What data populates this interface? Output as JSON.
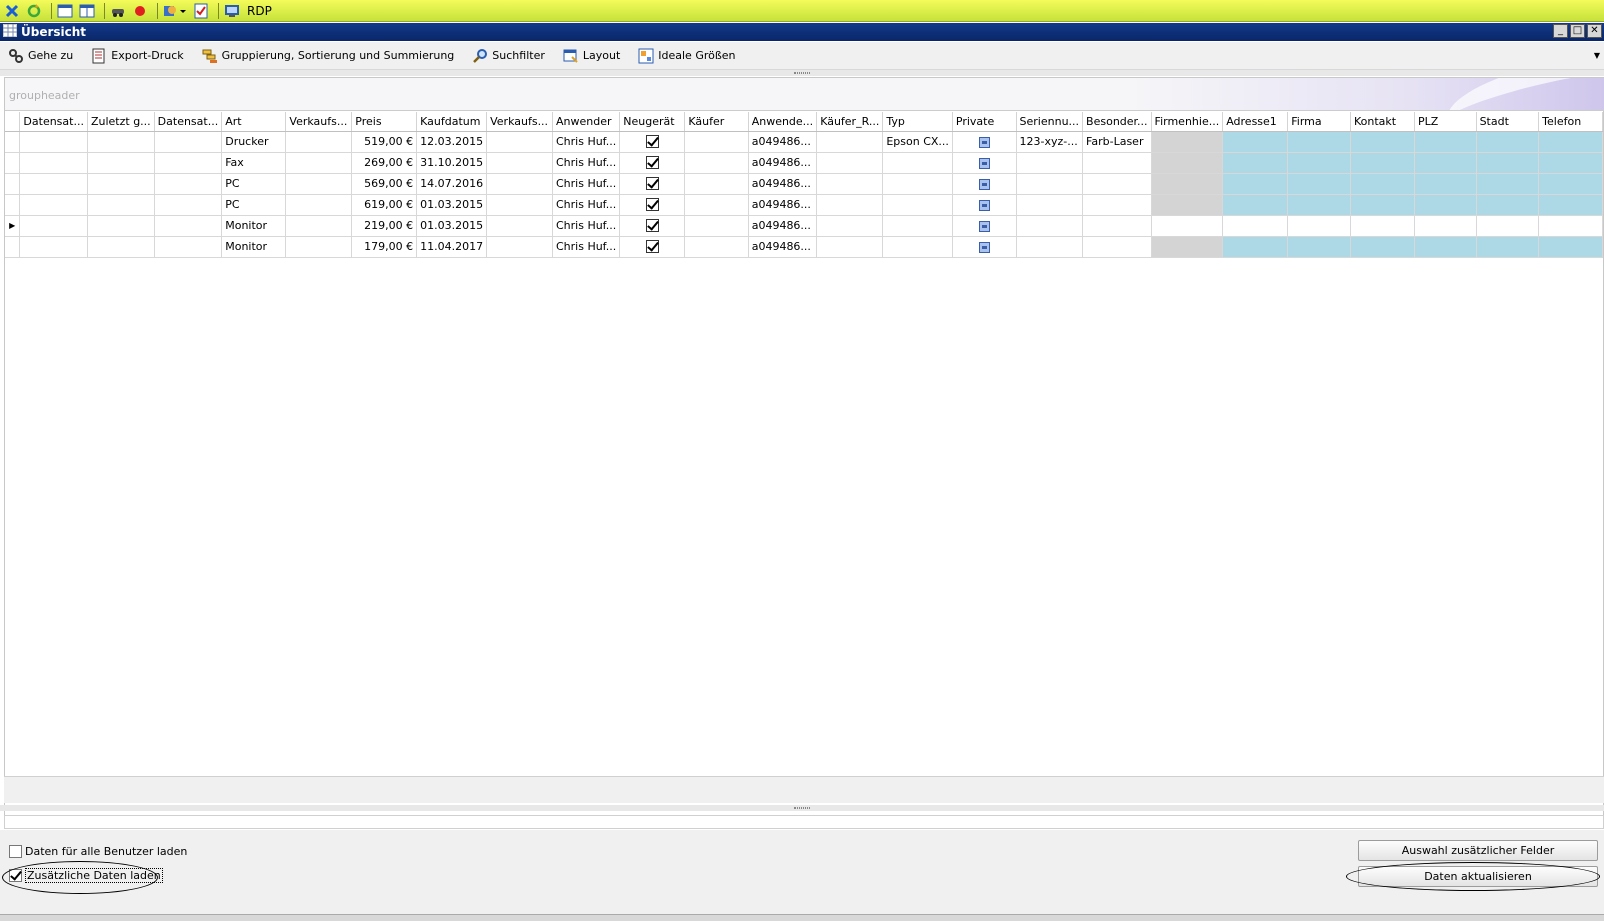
{
  "quickbar": {
    "rdp_label": "RDP"
  },
  "window": {
    "title": "Übersicht"
  },
  "toolbar": {
    "items": [
      {
        "label": "Gehe zu",
        "icon": "goto-icon"
      },
      {
        "label": "Export-Druck",
        "icon": "print-icon"
      },
      {
        "label": "Gruppierung, Sortierung und Summierung",
        "icon": "grouping-icon"
      },
      {
        "label": "Suchfilter",
        "icon": "search-filter-icon"
      },
      {
        "label": "Layout",
        "icon": "layout-icon"
      },
      {
        "label": "Ideale Größen",
        "icon": "ideal-size-icon"
      }
    ]
  },
  "grid": {
    "groupheader": "groupheader",
    "columns": [
      "Datensat...",
      "Zuletzt g...",
      "Datensat...",
      "Art",
      "Verkaufs...",
      "Preis",
      "Kaufdatum",
      "Verkaufs...",
      "Anwender",
      "Neugerät",
      "Käufer",
      "Anwende...",
      "Käufer_R...",
      "Typ",
      "Private",
      "Seriennu...",
      "Besonder...",
      "Firmenhie...",
      "Adresse1",
      "Firma",
      "Kontakt",
      "PLZ",
      "Stadt",
      "Telefon"
    ],
    "rows": [
      {
        "art": "Drucker",
        "preis": "519,00 €",
        "kaufdatum": "12.03.2015",
        "anwender": "Chris Huf...",
        "neugeraet": true,
        "anwender_id": "a049486...",
        "typ": "Epson CX...",
        "seriennummer": "123-xyz-...",
        "besonderheiten": "Farb-Laser",
        "selected": false
      },
      {
        "art": "Fax",
        "preis": "269,00 €",
        "kaufdatum": "31.10.2015",
        "anwender": "Chris Huf...",
        "neugeraet": true,
        "anwender_id": "a049486...",
        "typ": "",
        "seriennummer": "",
        "besonderheiten": "",
        "selected": false
      },
      {
        "art": "PC",
        "preis": "569,00 €",
        "kaufdatum": "14.07.2016",
        "anwender": "Chris Huf...",
        "neugeraet": true,
        "anwender_id": "a049486...",
        "typ": "",
        "seriennummer": "",
        "besonderheiten": "",
        "selected": false
      },
      {
        "art": "PC",
        "preis": "619,00 €",
        "kaufdatum": "01.03.2015",
        "anwender": "Chris Huf...",
        "neugeraet": true,
        "anwender_id": "a049486...",
        "typ": "",
        "seriennummer": "",
        "besonderheiten": "",
        "selected": false
      },
      {
        "art": "Monitor",
        "preis": "219,00 €",
        "kaufdatum": "01.03.2015",
        "anwender": "Chris Huf...",
        "neugeraet": true,
        "anwender_id": "a049486...",
        "typ": "",
        "seriennummer": "",
        "besonderheiten": "",
        "selected": true
      },
      {
        "art": "Monitor",
        "preis": "179,00 €",
        "kaufdatum": "11.04.2017",
        "anwender": "Chris Huf...",
        "neugeraet": true,
        "anwender_id": "a049486...",
        "typ": "",
        "seriennummer": "",
        "besonderheiten": "",
        "selected": false
      }
    ]
  },
  "options": {
    "load_all_users_label": "Daten für alle Benutzer laden",
    "load_all_users_checked": false,
    "load_additional_label": "Zusätzliche Daten laden",
    "load_additional_checked": true
  },
  "buttons": {
    "select_fields_label": "Auswahl zusätzlicher Felder",
    "refresh_label": "Daten aktualisieren"
  },
  "colors": {
    "titlebar": "#0a2668",
    "quickbar": "#d4ec45",
    "grey_cell": "#d4d4d4",
    "blue_cell": "#add8e6"
  }
}
